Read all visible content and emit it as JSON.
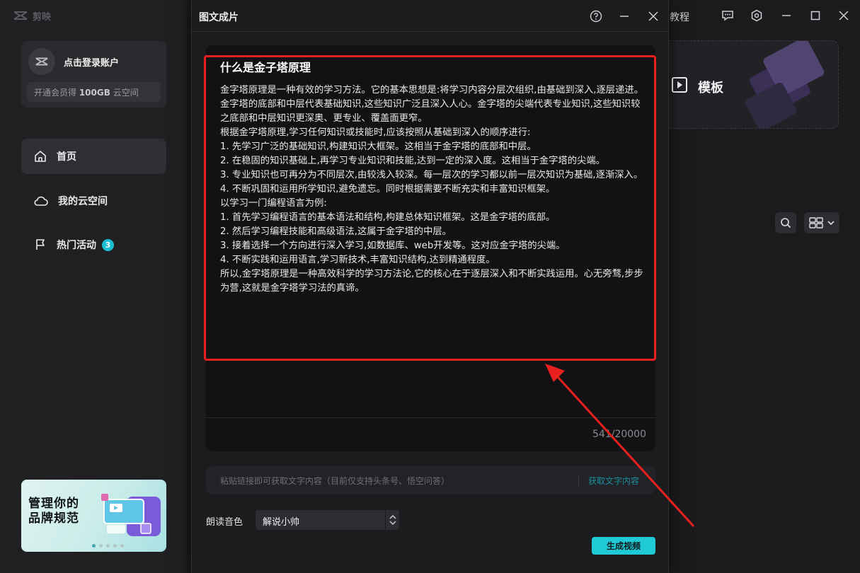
{
  "app": {
    "brand": "剪映"
  },
  "sidebar": {
    "login_text": "点击登录账户",
    "vip_prefix": "开通会员得 ",
    "vip_amount": "100GB",
    "vip_suffix": " 云空间",
    "items": [
      {
        "label": "首页",
        "icon": "home-icon",
        "active": true
      },
      {
        "label": "我的云空间",
        "icon": "cloud-icon",
        "active": false
      },
      {
        "label": "热门活动",
        "icon": "flag-icon",
        "active": false,
        "badge": "3"
      }
    ],
    "promo": {
      "line1": "管理你的",
      "line2": "品牌规范"
    }
  },
  "background": {
    "tutorial": "教程",
    "template_label": "模板"
  },
  "dialog": {
    "title": "图文成片",
    "article_title": "什么是金子塔原理",
    "article_paragraphs": [
      "金字塔原理是一种有效的学习方法。它的基本思想是:将学习内容分层次组织,由基础到深入,逐层递进。",
      "金字塔的底部和中层代表基础知识,这些知识广泛且深入人心。金字塔的尖端代表专业知识,这些知识较之底部和中层知识更深奥、更专业、覆盖面更窄。",
      "根据金字塔原理,学习任何知识或技能时,应该按照从基础到深入的顺序进行:",
      "1. 先学习广泛的基础知识,构建知识大框架。这相当于金字塔的底部和中层。",
      "2. 在稳固的知识基础上,再学习专业知识和技能,达到一定的深入度。这相当于金字塔的尖端。",
      "3. 专业知识也可再分为不同层次,由较浅入较深。每一层次的学习都以前一层次知识为基础,逐渐深入。",
      "4. 不断巩固和运用所学知识,避免遗忘。同时根据需要不断充实和丰富知识框架。",
      "以学习一门编程语言为例:",
      "1. 首先学习编程语言的基本语法和结构,构建总体知识框架。这是金字塔的底部。",
      "2. 然后学习编程技能和高级语法,这属于金字塔的中层。",
      "3. 接着选择一个方向进行深入学习,如数据库、web开发等。这对应金字塔的尖端。",
      "4. 不断实践和运用语言,学习新技术,丰富知识结构,达到精通程度。",
      "所以,金字塔原理是一种高效科学的学习方法论,它的核心在于逐层深入和不断实践运用。心无旁骛,步步为营,这就是金字塔学习法的真谛。"
    ],
    "char_count": "541/20000",
    "link_placeholder": "粘贴链接即可获取文字内容（目前仅支持头条号、悟空问答）",
    "link_action": "获取文字内容",
    "voice_label": "朗读音色",
    "voice_value": "解说小帅",
    "generate_button": "生成视频"
  },
  "colors": {
    "accent": "#20c9d6",
    "annotation_red": "#e8211e"
  }
}
